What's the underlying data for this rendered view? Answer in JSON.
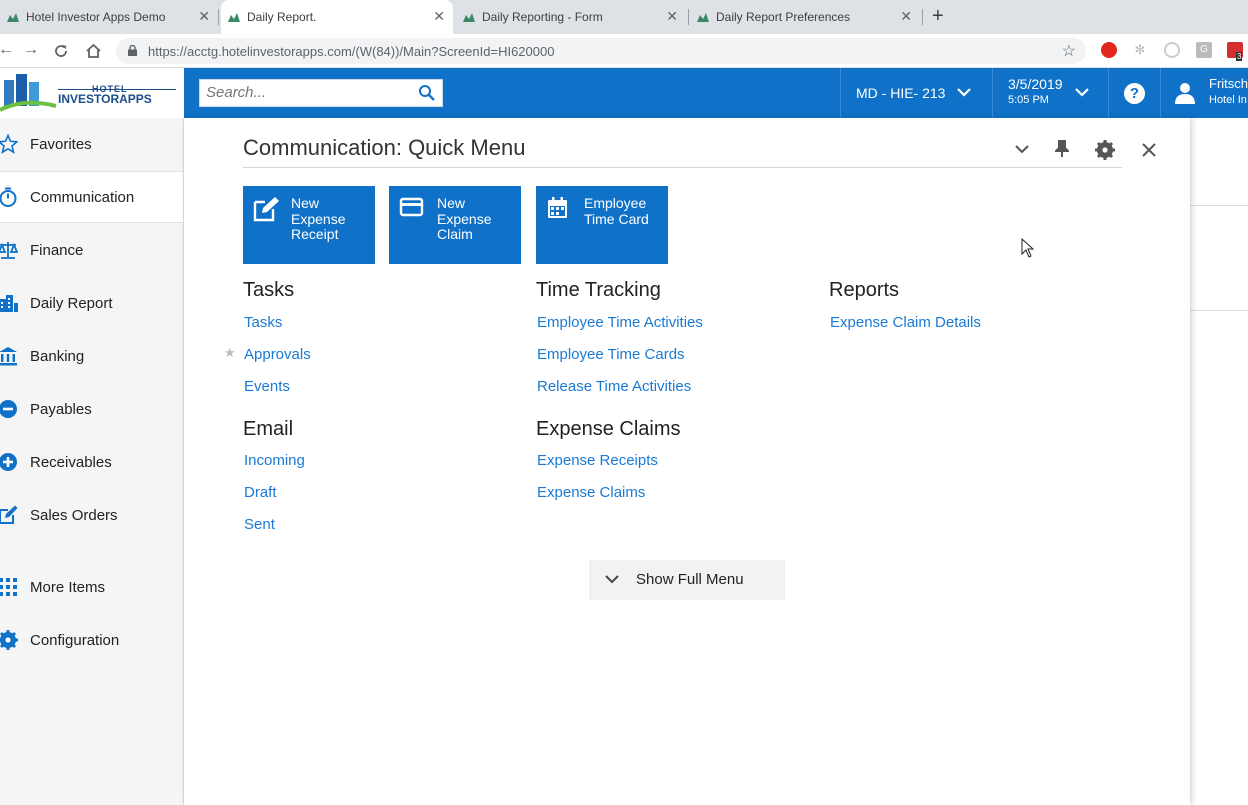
{
  "browser": {
    "tabs": [
      {
        "title": "Hotel Investor Apps Demo",
        "active": false
      },
      {
        "title": "Daily Report.",
        "active": true
      },
      {
        "title": "Daily Reporting - Form",
        "active": false
      },
      {
        "title": "Daily Report Preferences",
        "active": false
      }
    ],
    "url": "https://acctg.hotelinvestorapps.com/(W(84))/Main?ScreenId=HI620000",
    "extension_badge": "3"
  },
  "header": {
    "logo_top": "HOTEL",
    "logo_bottom": "INVESTORAPPS",
    "search_placeholder": "Search...",
    "branch": "MD - HIE- 213",
    "date": "3/5/2019",
    "time": "5:05 PM",
    "help": "?",
    "user_name": "Fritsch",
    "user_company": "Hotel In"
  },
  "sidebar": {
    "items": [
      {
        "label": "Favorites",
        "icon": "star-icon"
      },
      {
        "label": "Communication",
        "icon": "stopwatch-icon"
      },
      {
        "label": "Finance",
        "icon": "scales-icon"
      },
      {
        "label": "Daily Report",
        "icon": "building-icon"
      },
      {
        "label": "Banking",
        "icon": "bank-icon"
      },
      {
        "label": "Payables",
        "icon": "minus-circle-icon"
      },
      {
        "label": "Receivables",
        "icon": "plus-circle-icon"
      },
      {
        "label": "Sales Orders",
        "icon": "edit-icon"
      },
      {
        "label": "More Items",
        "icon": "grid-icon"
      },
      {
        "label": "Configuration",
        "icon": "gear-icon"
      }
    ]
  },
  "quick_menu": {
    "title": "Communication: Quick Menu",
    "tiles": [
      {
        "label": "New Expense Receipt",
        "icon": "edit-icon"
      },
      {
        "label": "New Expense Claim",
        "icon": "card-icon"
      },
      {
        "label": "Employee Time Card",
        "icon": "calendar-icon"
      }
    ],
    "sections": {
      "tasks": {
        "title": "Tasks",
        "links": [
          "Tasks",
          "Approvals",
          "Events"
        ]
      },
      "email": {
        "title": "Email",
        "links": [
          "Incoming",
          "Draft",
          "Sent"
        ]
      },
      "time_tracking": {
        "title": "Time Tracking",
        "links": [
          "Employee Time Activities",
          "Employee Time Cards",
          "Release Time Activities"
        ]
      },
      "expense_claims": {
        "title": "Expense Claims",
        "links": [
          "Expense Receipts",
          "Expense Claims"
        ]
      },
      "reports": {
        "title": "Reports",
        "links": [
          "Expense Claim Details"
        ]
      }
    },
    "show_full_menu": "Show Full Menu"
  },
  "colors": {
    "brand_blue": "#0f72c8",
    "link_blue": "#1a7ad4"
  }
}
